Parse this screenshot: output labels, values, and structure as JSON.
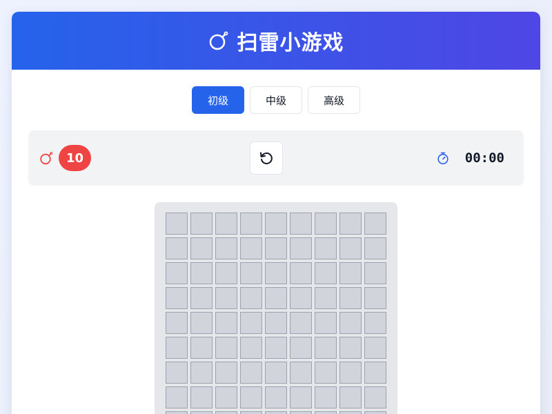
{
  "header": {
    "title": "扫雷小游戏",
    "icon": "bomb-icon"
  },
  "levels": [
    {
      "label": "初级",
      "active": true
    },
    {
      "label": "中级",
      "active": false
    },
    {
      "label": "高级",
      "active": false
    }
  ],
  "status": {
    "mines_remaining": "10",
    "reset_icon": "reset-icon",
    "timer_icon": "stopwatch-icon",
    "time": "00:00"
  },
  "board": {
    "rows": 9,
    "cols": 9,
    "state": "all-covered"
  },
  "colors": {
    "header_start": "#2563eb",
    "header_end": "#4f46e5",
    "accent": "#2563eb",
    "mine_badge": "#ef4444",
    "timer_icon": "#2563eb",
    "cell_covered": "#d1d5db"
  }
}
